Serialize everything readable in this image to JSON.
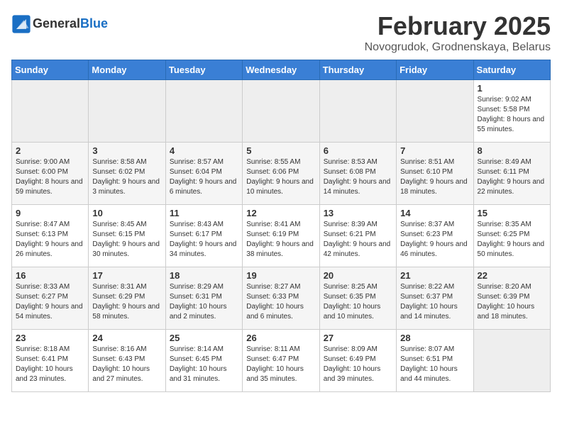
{
  "header": {
    "logo_general": "General",
    "logo_blue": "Blue",
    "title": "February 2025",
    "subtitle": "Novogrudok, Grodnenskaya, Belarus"
  },
  "days_of_week": [
    "Sunday",
    "Monday",
    "Tuesday",
    "Wednesday",
    "Thursday",
    "Friday",
    "Saturday"
  ],
  "weeks": [
    [
      {
        "day": "",
        "info": ""
      },
      {
        "day": "",
        "info": ""
      },
      {
        "day": "",
        "info": ""
      },
      {
        "day": "",
        "info": ""
      },
      {
        "day": "",
        "info": ""
      },
      {
        "day": "",
        "info": ""
      },
      {
        "day": "1",
        "info": "Sunrise: 9:02 AM\nSunset: 5:58 PM\nDaylight: 8 hours and 55 minutes."
      }
    ],
    [
      {
        "day": "2",
        "info": "Sunrise: 9:00 AM\nSunset: 6:00 PM\nDaylight: 8 hours and 59 minutes."
      },
      {
        "day": "3",
        "info": "Sunrise: 8:58 AM\nSunset: 6:02 PM\nDaylight: 9 hours and 3 minutes."
      },
      {
        "day": "4",
        "info": "Sunrise: 8:57 AM\nSunset: 6:04 PM\nDaylight: 9 hours and 6 minutes."
      },
      {
        "day": "5",
        "info": "Sunrise: 8:55 AM\nSunset: 6:06 PM\nDaylight: 9 hours and 10 minutes."
      },
      {
        "day": "6",
        "info": "Sunrise: 8:53 AM\nSunset: 6:08 PM\nDaylight: 9 hours and 14 minutes."
      },
      {
        "day": "7",
        "info": "Sunrise: 8:51 AM\nSunset: 6:10 PM\nDaylight: 9 hours and 18 minutes."
      },
      {
        "day": "8",
        "info": "Sunrise: 8:49 AM\nSunset: 6:11 PM\nDaylight: 9 hours and 22 minutes."
      }
    ],
    [
      {
        "day": "9",
        "info": "Sunrise: 8:47 AM\nSunset: 6:13 PM\nDaylight: 9 hours and 26 minutes."
      },
      {
        "day": "10",
        "info": "Sunrise: 8:45 AM\nSunset: 6:15 PM\nDaylight: 9 hours and 30 minutes."
      },
      {
        "day": "11",
        "info": "Sunrise: 8:43 AM\nSunset: 6:17 PM\nDaylight: 9 hours and 34 minutes."
      },
      {
        "day": "12",
        "info": "Sunrise: 8:41 AM\nSunset: 6:19 PM\nDaylight: 9 hours and 38 minutes."
      },
      {
        "day": "13",
        "info": "Sunrise: 8:39 AM\nSunset: 6:21 PM\nDaylight: 9 hours and 42 minutes."
      },
      {
        "day": "14",
        "info": "Sunrise: 8:37 AM\nSunset: 6:23 PM\nDaylight: 9 hours and 46 minutes."
      },
      {
        "day": "15",
        "info": "Sunrise: 8:35 AM\nSunset: 6:25 PM\nDaylight: 9 hours and 50 minutes."
      }
    ],
    [
      {
        "day": "16",
        "info": "Sunrise: 8:33 AM\nSunset: 6:27 PM\nDaylight: 9 hours and 54 minutes."
      },
      {
        "day": "17",
        "info": "Sunrise: 8:31 AM\nSunset: 6:29 PM\nDaylight: 9 hours and 58 minutes."
      },
      {
        "day": "18",
        "info": "Sunrise: 8:29 AM\nSunset: 6:31 PM\nDaylight: 10 hours and 2 minutes."
      },
      {
        "day": "19",
        "info": "Sunrise: 8:27 AM\nSunset: 6:33 PM\nDaylight: 10 hours and 6 minutes."
      },
      {
        "day": "20",
        "info": "Sunrise: 8:25 AM\nSunset: 6:35 PM\nDaylight: 10 hours and 10 minutes."
      },
      {
        "day": "21",
        "info": "Sunrise: 8:22 AM\nSunset: 6:37 PM\nDaylight: 10 hours and 14 minutes."
      },
      {
        "day": "22",
        "info": "Sunrise: 8:20 AM\nSunset: 6:39 PM\nDaylight: 10 hours and 18 minutes."
      }
    ],
    [
      {
        "day": "23",
        "info": "Sunrise: 8:18 AM\nSunset: 6:41 PM\nDaylight: 10 hours and 23 minutes."
      },
      {
        "day": "24",
        "info": "Sunrise: 8:16 AM\nSunset: 6:43 PM\nDaylight: 10 hours and 27 minutes."
      },
      {
        "day": "25",
        "info": "Sunrise: 8:14 AM\nSunset: 6:45 PM\nDaylight: 10 hours and 31 minutes."
      },
      {
        "day": "26",
        "info": "Sunrise: 8:11 AM\nSunset: 6:47 PM\nDaylight: 10 hours and 35 minutes."
      },
      {
        "day": "27",
        "info": "Sunrise: 8:09 AM\nSunset: 6:49 PM\nDaylight: 10 hours and 39 minutes."
      },
      {
        "day": "28",
        "info": "Sunrise: 8:07 AM\nSunset: 6:51 PM\nDaylight: 10 hours and 44 minutes."
      },
      {
        "day": "",
        "info": ""
      }
    ]
  ]
}
